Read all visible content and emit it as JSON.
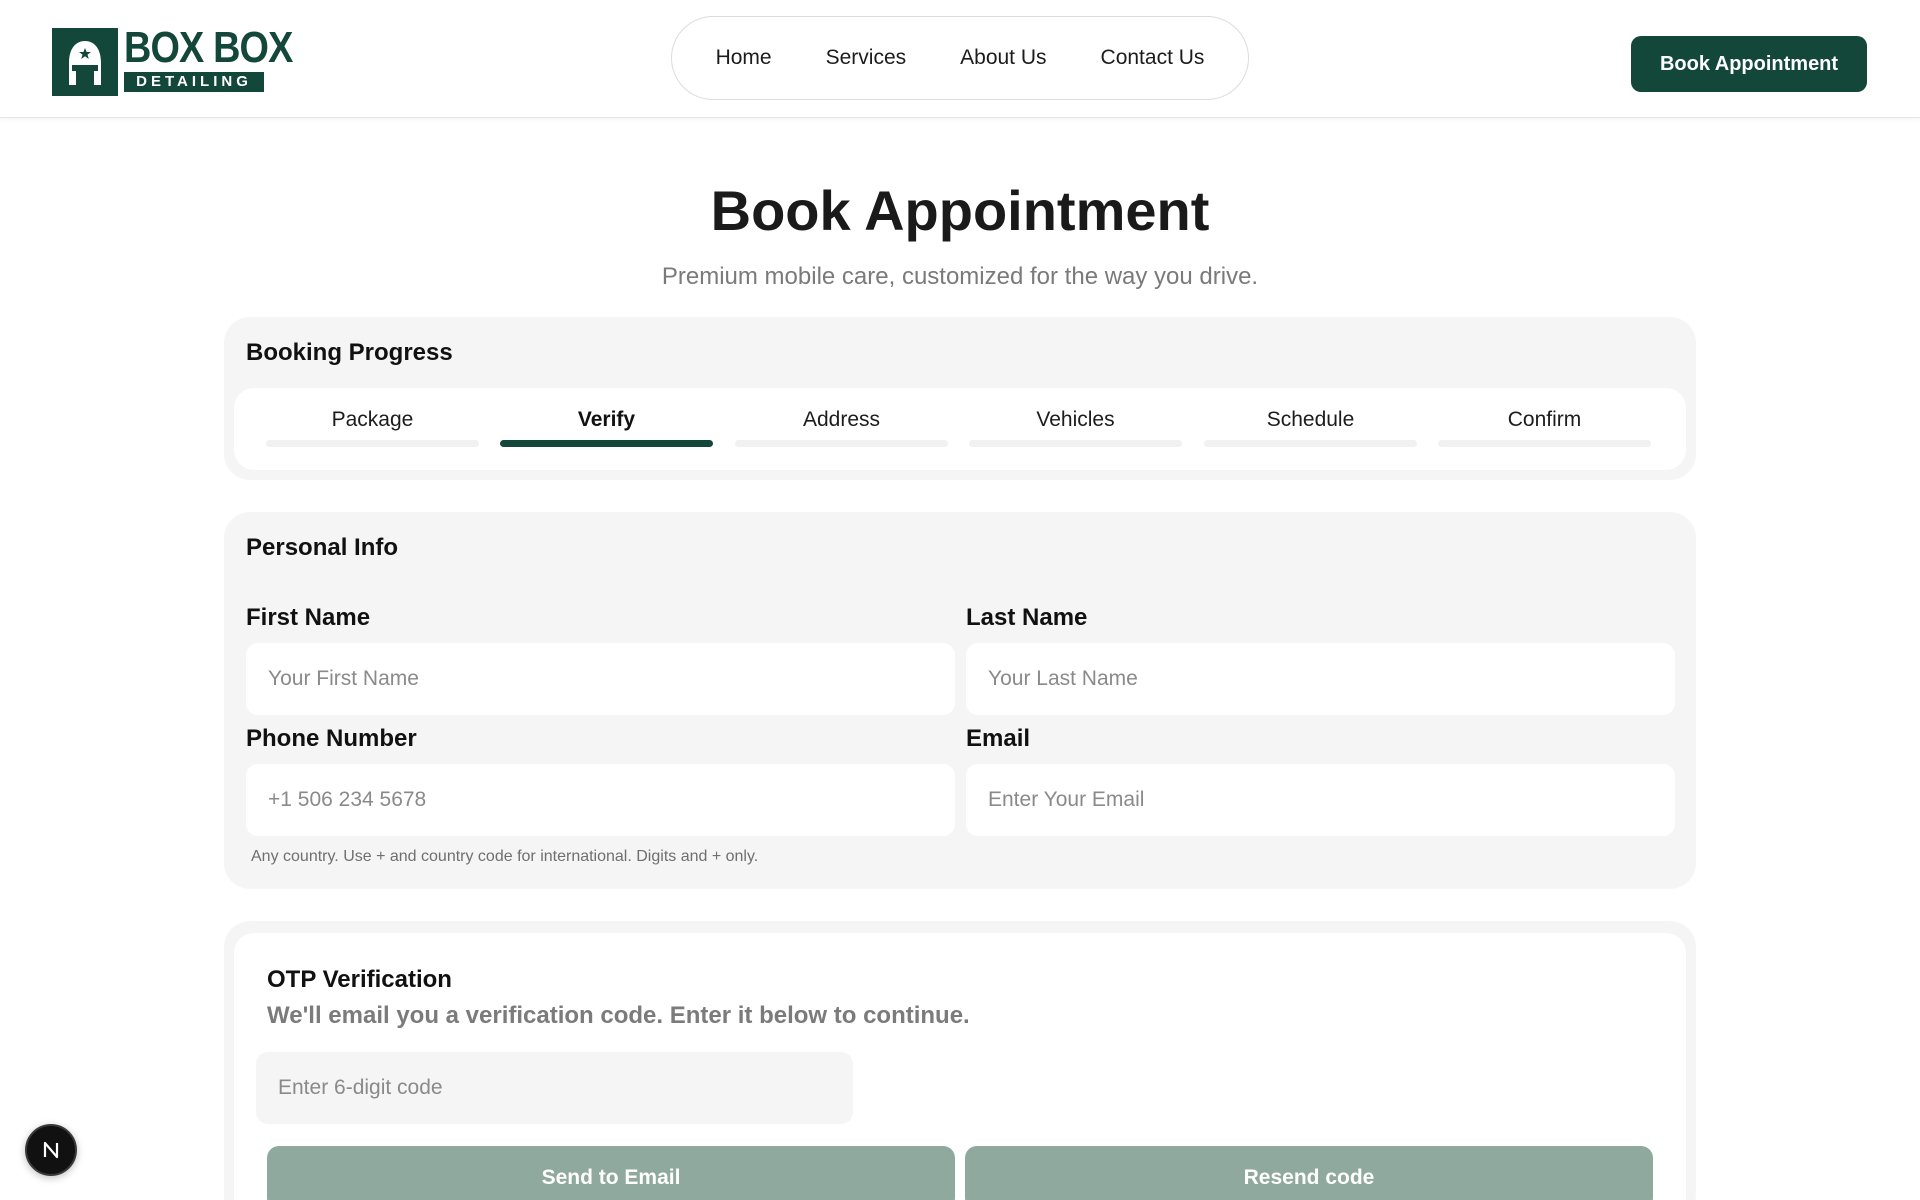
{
  "brand": {
    "name": "BOX BOX",
    "tagline": "DETAILING",
    "color": "#12473a"
  },
  "nav": {
    "items": [
      "Home",
      "Services",
      "About Us",
      "Contact Us"
    ]
  },
  "header": {
    "cta_label": "Book Appointment"
  },
  "page": {
    "title": "Book Appointment",
    "subtitle": "Premium mobile care, customized for the way you drive."
  },
  "progress": {
    "title": "Booking Progress",
    "steps": [
      "Package",
      "Verify",
      "Address",
      "Vehicles",
      "Schedule",
      "Confirm"
    ],
    "active_step": "Verify"
  },
  "personal_info": {
    "title": "Personal Info",
    "first_name": {
      "label": "First Name",
      "placeholder": "Your First Name",
      "value": ""
    },
    "last_name": {
      "label": "Last Name",
      "placeholder": "Your Last Name",
      "value": ""
    },
    "phone": {
      "label": "Phone Number",
      "placeholder": "+1 506 234 5678",
      "value": ""
    },
    "email": {
      "label": "Email",
      "placeholder": "Enter Your Email",
      "value": ""
    },
    "phone_hint": "Any country. Use + and country code for international. Digits and + only."
  },
  "otp": {
    "title": "OTP Verification",
    "description": "We'll email you a verification code. Enter it below to continue.",
    "placeholder": "Enter 6-digit code",
    "send_label": "Send to Email",
    "resend_label": "Resend code",
    "button_color": "#8fa99f"
  },
  "dev_badge": {
    "letter": "N"
  }
}
